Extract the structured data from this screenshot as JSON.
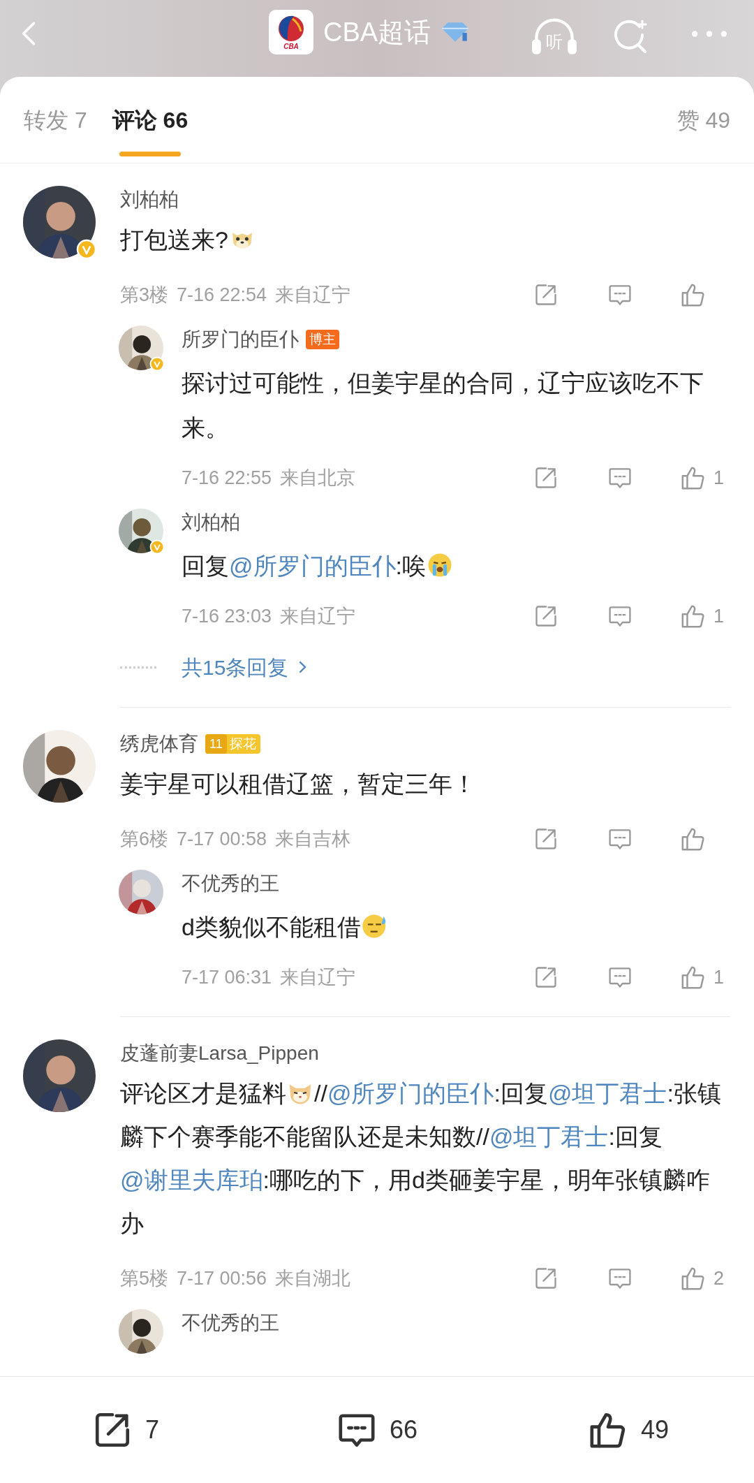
{
  "header": {
    "title": "CBA超话",
    "logo_text": "CBA",
    "listen_label": "听"
  },
  "tabs": [
    {
      "label": "转发 7",
      "selected": false
    },
    {
      "label": "评论 66",
      "selected": true
    }
  ],
  "likes_tab": "赞 49",
  "comments": [
    {
      "name": "刘柏柏",
      "verified": true,
      "segments": [
        {
          "kind": "text",
          "text": "打包送来?"
        },
        {
          "kind": "doge"
        }
      ],
      "floor": "第3楼",
      "time": "7-16 22:54",
      "location": "来自辽宁",
      "replies": [
        {
          "name": "所罗门的臣仆",
          "verified": true,
          "badge": {
            "kind": "host",
            "label": "博主"
          },
          "segments": [
            {
              "kind": "text",
              "text": "探讨过可能性，但姜宇星的合同，辽宁应该吃不下来。"
            }
          ],
          "time": "7-16 22:55",
          "location": "来自北京",
          "likes": "1"
        },
        {
          "name": "刘柏柏",
          "verified": true,
          "segments": [
            {
              "kind": "text",
              "text": "回复"
            },
            {
              "kind": "mention",
              "text": "@所罗门的臣仆"
            },
            {
              "kind": "text",
              "text": ":唉"
            },
            {
              "kind": "cry"
            }
          ],
          "time": "7-16 23:03",
          "location": "来自辽宁",
          "likes": "1"
        }
      ],
      "more_replies": "共15条回复"
    },
    {
      "name": "绣虎体育",
      "verified": false,
      "badge": {
        "kind": "rank",
        "level": "11",
        "label": "探花"
      },
      "segments": [
        {
          "kind": "text",
          "text": "姜宇星可以租借辽篮，暂定三年！"
        }
      ],
      "floor": "第6楼",
      "time": "7-17 00:58",
      "location": "来自吉林",
      "replies": [
        {
          "name": "不优秀的王",
          "verified": false,
          "segments": [
            {
              "kind": "text",
              "text": "d类貌似不能租借"
            },
            {
              "kind": "sweat"
            }
          ],
          "time": "7-17 06:31",
          "location": "来自辽宁",
          "likes": "1"
        }
      ]
    },
    {
      "name": "皮蓬前妻Larsa_Pippen",
      "verified": false,
      "segments": [
        {
          "kind": "text",
          "text": "评论区才是猛料"
        },
        {
          "kind": "cat"
        },
        {
          "kind": "text",
          "text": "//"
        },
        {
          "kind": "mention",
          "text": "@所罗门的臣仆"
        },
        {
          "kind": "text",
          "text": ":回复"
        },
        {
          "kind": "mention",
          "text": "@坦丁君士"
        },
        {
          "kind": "text",
          "text": ":张镇麟下个赛季能不能留队还是未知数//"
        },
        {
          "kind": "mention",
          "text": "@坦丁君士"
        },
        {
          "kind": "text",
          "text": ":回复"
        },
        {
          "kind": "mention",
          "text": "@谢里夫库珀"
        },
        {
          "kind": "text",
          "text": ":哪吃的下，用d类砸姜宇星，明年张镇麟咋办"
        }
      ],
      "floor": "第5楼",
      "time": "7-17 00:56",
      "location": "来自湖北",
      "likes": "2",
      "replies": [
        {
          "name": "不优秀的王",
          "verified": false
        }
      ]
    }
  ],
  "bottom_bar": [
    {
      "kind": "share",
      "count": "7"
    },
    {
      "kind": "comment",
      "count": "66"
    },
    {
      "kind": "like",
      "count": "49"
    }
  ]
}
